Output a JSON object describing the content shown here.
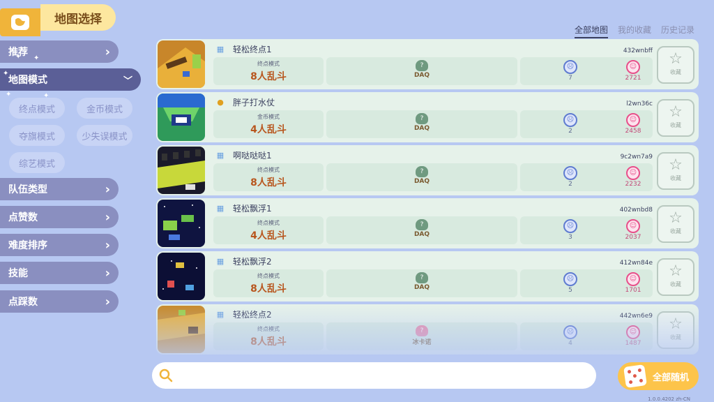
{
  "header": {
    "title": "地图选择"
  },
  "tabs": [
    {
      "label": "全部地图",
      "active": true
    },
    {
      "label": "我的收藏",
      "active": false
    },
    {
      "label": "历史记录",
      "active": false
    }
  ],
  "sidebar": {
    "items": [
      {
        "label": "推荐"
      },
      {
        "label": "地图模式",
        "active": true
      },
      {
        "label": "队伍类型"
      },
      {
        "label": "点赞数"
      },
      {
        "label": "难度排序"
      },
      {
        "label": "技能"
      },
      {
        "label": "点踩数"
      }
    ],
    "sub_modes": [
      "终点模式",
      "金币模式",
      "夺旗模式",
      "少失误模式",
      "综艺模式"
    ]
  },
  "maps": [
    {
      "title": "轻松终点1",
      "code": "432wnbff",
      "mode_label": "终点模式",
      "mode_value": "8人乱斗",
      "author": "DAQ",
      "dislikes": "7",
      "likes": "2721",
      "fav_label": "收藏",
      "icon": "blue-grid-icon"
    },
    {
      "title": "胖子打水仗",
      "code": "l2wn36c",
      "mode_label": "金币模式",
      "mode_value": "4人乱斗",
      "author": "DAQ",
      "dislikes": "2",
      "likes": "2458",
      "fav_label": "收藏",
      "icon": "gold-coin-icon"
    },
    {
      "title": "啊哒哒哒1",
      "code": "9c2wn7a9",
      "mode_label": "终点模式",
      "mode_value": "8人乱斗",
      "author": "DAQ",
      "dislikes": "2",
      "likes": "2232",
      "fav_label": "收藏",
      "icon": "blue-grid-icon"
    },
    {
      "title": "轻松飘浮1",
      "code": "402wnbd8",
      "mode_label": "终点模式",
      "mode_value": "4人乱斗",
      "author": "DAQ",
      "dislikes": "3",
      "likes": "2037",
      "fav_label": "收藏",
      "icon": "blue-grid-icon"
    },
    {
      "title": "轻松飘浮2",
      "code": "412wn84e",
      "mode_label": "终点模式",
      "mode_value": "8人乱斗",
      "author": "DAQ",
      "dislikes": "5",
      "likes": "1701",
      "fav_label": "收藏",
      "icon": "blue-grid-icon"
    },
    {
      "title": "轻松终点2",
      "code": "442wn6e9",
      "mode_label": "终点模式",
      "mode_value": "8人乱斗",
      "author": "冰卡诺",
      "dislikes": "4",
      "likes": "1487",
      "fav_label": "收藏",
      "icon": "blue-grid-icon"
    }
  ],
  "bottom": {
    "search_placeholder": "",
    "random_label": "全部随机",
    "version": "1.0.0.4202 zh-CN"
  },
  "colors": {
    "background": "#b7c8f2",
    "accent": "#fdc44a",
    "row_background": "#e6f2ea"
  }
}
